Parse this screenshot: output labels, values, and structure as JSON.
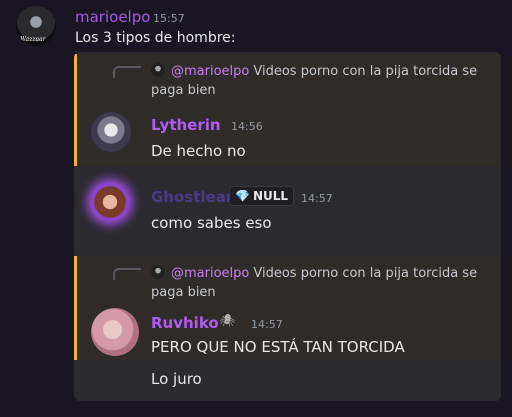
{
  "top_message": {
    "author": "marioelpo",
    "author_color": "#a758e6",
    "timestamp": "15:57",
    "text": "Los 3 tipos de hombre:",
    "avatar_tag": "Wazzaar"
  },
  "embed": {
    "accent_color": "#f0b232",
    "messages": [
      {
        "reply": {
          "mention": "@marioelpo",
          "text": "Videos porno con la pija torcida se paga bien"
        },
        "author": "Lytherin",
        "author_color": "#b25cf3",
        "timestamp": "14:56",
        "lines": [
          "De hecho no"
        ]
      },
      {
        "author": "Ghostlean",
        "author_color": "#4b3a8a",
        "badge_icon": "💎",
        "badge": "NULL",
        "timestamp": "14:57",
        "lines": [
          "como sabes eso"
        ]
      },
      {
        "reply": {
          "mention": "@marioelpo",
          "text": "Videos porno con la pija torcida se paga bien"
        },
        "author": "Ruvhiko",
        "author_color": "#b25cf3",
        "author_icon": "🕷",
        "timestamp": "14:57",
        "lines": [
          "PERO QUE NO ESTÁ TAN TORCIDA",
          "Lo juro"
        ]
      }
    ]
  }
}
